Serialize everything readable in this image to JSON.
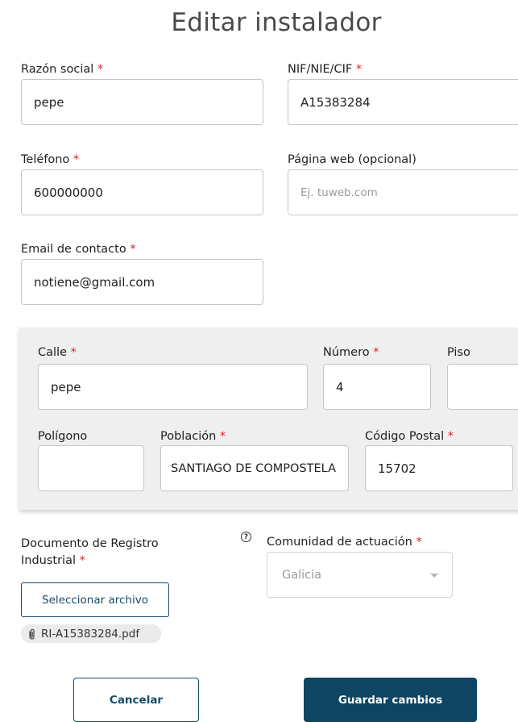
{
  "page": {
    "title": "Editar instalador"
  },
  "required_mark": "*",
  "form": {
    "razon_social": {
      "label": "Razón social",
      "value": "pepe"
    },
    "nif": {
      "label": "NIF/NIE/CIF",
      "value": "A15383284"
    },
    "telefono": {
      "label": "Teléfono",
      "value": "600000000"
    },
    "web": {
      "label": "Página web (opcional)",
      "placeholder": "Ej. tuweb.com"
    },
    "email": {
      "label": "Email de contacto",
      "value": "notiene@gmail.com"
    }
  },
  "address": {
    "calle": {
      "label": "Calle",
      "value": "pepe"
    },
    "numero": {
      "label": "Número",
      "value": "4"
    },
    "piso": {
      "label": "Piso",
      "value": ""
    },
    "poligono": {
      "label": "Polígono",
      "value": ""
    },
    "poblacion": {
      "label": "Población",
      "value": "SANTIAGO DE COMPOSTELA"
    },
    "codigo_postal": {
      "label": "Código Postal",
      "value": "15702"
    }
  },
  "documento": {
    "label_line1": "Documento de Registro",
    "label_line2": "Industrial",
    "help_glyph": "?",
    "select_button": "Seleccionar archivo",
    "file_name": "RI-A15383284.pdf",
    "file_icon": "paperclip-icon"
  },
  "comunidad": {
    "label": "Comunidad de actuación",
    "value": "Galicia"
  },
  "actions": {
    "cancel": "Cancelar",
    "save": "Guardar cambios"
  },
  "colors": {
    "primary": "#0d4563",
    "required": "#d8232a",
    "panel_bg": "#efefef"
  }
}
